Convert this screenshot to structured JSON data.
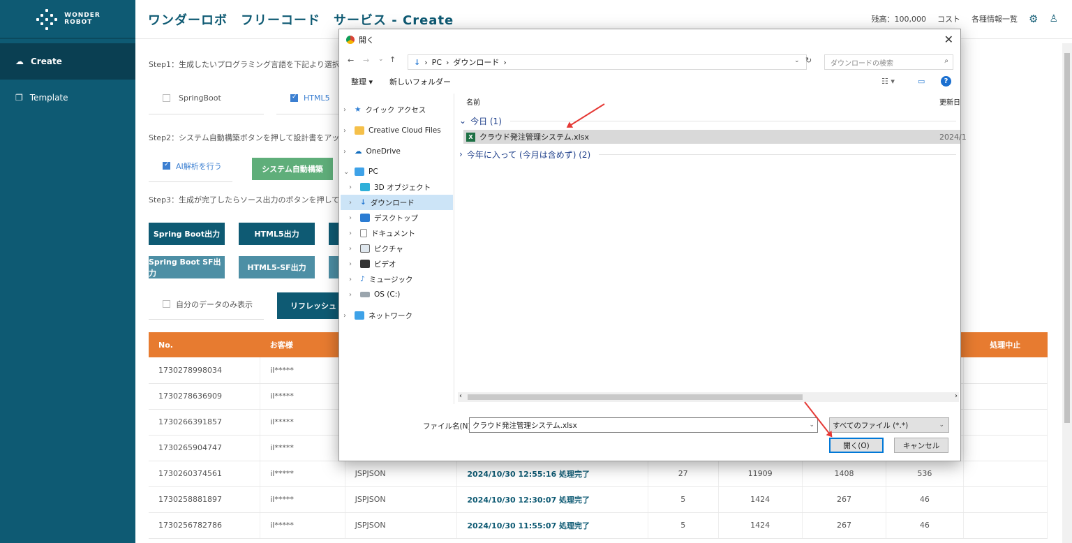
{
  "app": {
    "title": "ワンダーロボ　フリーコード　サービス - Create",
    "logo_line1": "WONDER",
    "logo_line2": "ROBOT",
    "balance": "残高：100,000",
    "cost": "コスト",
    "info_list": "各種情報一覧"
  },
  "sidebar": {
    "items": [
      {
        "label": "Create",
        "icon": "cloud-upload-icon"
      },
      {
        "label": "Template",
        "icon": "copy-icon"
      }
    ]
  },
  "steps": {
    "step1": "Step1：生成したいプログラミング言語を下記より選択",
    "step2": "Step2：システム自動構築ボタンを押して設計書をアッ",
    "step3": "Step3：生成が完了したらソース出力のボタンを押して"
  },
  "languages": {
    "springboot": "SpringBoot",
    "html5": "HTML5"
  },
  "ai_check": "AI解析を行う",
  "auto_build": "システム自動構築",
  "output_buttons": {
    "spring": "Spring Boot出力",
    "html5": "HTML5出力",
    "spring_sf": "Spring Boot SF出力",
    "html5_sf": "HTML5-SF出力"
  },
  "only_mine": "自分のデータのみ表示",
  "refresh": "リフレッシュ",
  "table": {
    "headers": [
      "No.",
      "お客様",
      "",
      "",
      "",
      "",
      "",
      "",
      "処理中止"
    ],
    "rows": [
      [
        "1730278998034",
        "il*****",
        "",
        "",
        "",
        "",
        "",
        ""
      ],
      [
        "1730278636909",
        "il*****",
        "",
        "",
        "",
        "",
        "",
        ""
      ],
      [
        "1730266391857",
        "il*****",
        "",
        "",
        "",
        "",
        "",
        ""
      ],
      [
        "1730265904747",
        "il*****",
        "",
        "",
        "",
        "",
        "",
        ""
      ],
      [
        "1730260374561",
        "il*****",
        "JSPJSON",
        "2024/10/30 12:55:16 処理完了",
        "27",
        "11909",
        "1408",
        "536"
      ],
      [
        "1730258881897",
        "il*****",
        "JSPJSON",
        "2024/10/30 12:30:07 処理完了",
        "5",
        "1424",
        "267",
        "46"
      ],
      [
        "1730256782786",
        "il*****",
        "JSPJSON",
        "2024/10/30 11:55:07 処理完了",
        "5",
        "1424",
        "267",
        "46"
      ]
    ]
  },
  "dialog": {
    "title": "開く",
    "breadcrumb": [
      "PC",
      "ダウンロード"
    ],
    "search_placeholder": "ダウンロードの検索",
    "organize": "整理 ▾",
    "new_folder": "新しいフォルダー",
    "col_name": "名前",
    "col_date": "更新日",
    "group_today": "今日 (1)",
    "group_thisyear": "今年に入って (今月は含めず) (2)",
    "file_name": "クラウド発注管理システム.xlsx",
    "file_date": "2024/1",
    "tree": [
      "クイック アクセス",
      "Creative Cloud Files",
      "OneDrive",
      "PC",
      "3D オブジェクト",
      "ダウンロード",
      "デスクトップ",
      "ドキュメント",
      "ピクチャ",
      "ビデオ",
      "ミュージック",
      "OS (C:)",
      "ネットワーク"
    ],
    "filename_label": "ファイル名(N):",
    "filename_value": "クラウド発注管理システム.xlsx",
    "filetype": "すべてのファイル (*.*)",
    "open": "開く(O)",
    "cancel": "キャンセル"
  }
}
